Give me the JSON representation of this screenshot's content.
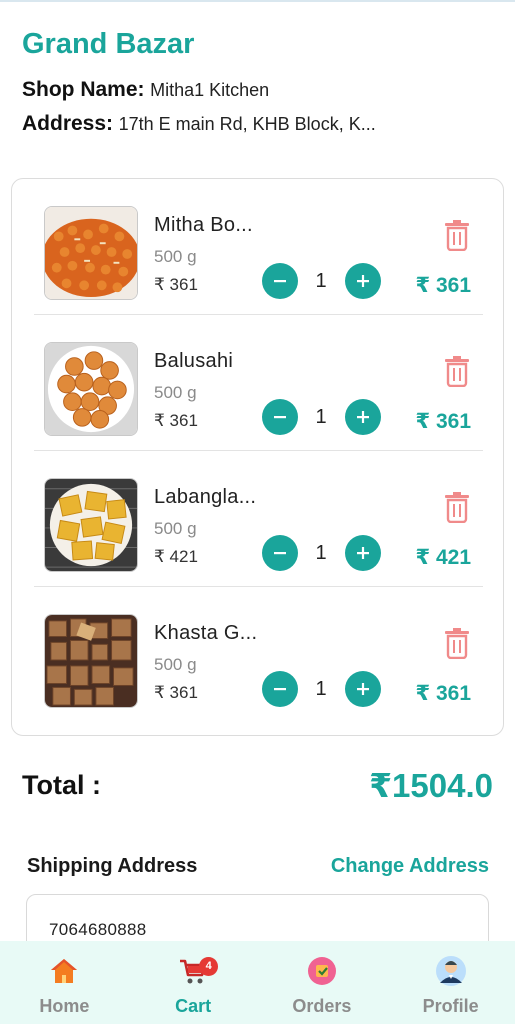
{
  "app": {
    "title": "Grand Bazar"
  },
  "shop": {
    "name_label": "Shop Name:",
    "name_value": "Mitha1 Kitchen",
    "address_label": "Address:",
    "address_value": "17th E main Rd, KHB Block, K..."
  },
  "cart": {
    "items": [
      {
        "name": "Mitha Bo...",
        "weight": "500 g",
        "price": "₹ 361",
        "qty": "1",
        "total": "₹ 361",
        "image": "mitha-boondi-photo"
      },
      {
        "name": "Balusahi",
        "weight": "500 g",
        "price": "₹ 361",
        "qty": "1",
        "total": "₹ 361",
        "image": "balusahi-photo"
      },
      {
        "name": "Labangla...",
        "weight": "500 g",
        "price": "₹ 421",
        "qty": "1",
        "total": "₹ 421",
        "image": "labangalatika-photo"
      },
      {
        "name": "Khasta G...",
        "weight": "500 g",
        "price": "₹ 361",
        "qty": "1",
        "total": "₹ 361",
        "image": "khasta-gaja-photo"
      }
    ],
    "minus_icon": "minus-icon",
    "plus_icon": "plus-icon",
    "delete_icon": "trash-icon"
  },
  "summary": {
    "total_label": "Total :",
    "total_value": "₹1504.0"
  },
  "shipping": {
    "title": "Shipping Address",
    "change_label": "Change Address",
    "phone": "7064680888"
  },
  "nav": {
    "items": [
      {
        "label": "Home",
        "icon": "home-icon",
        "active": false
      },
      {
        "label": "Cart",
        "icon": "cart-icon",
        "active": true,
        "badge": "4"
      },
      {
        "label": "Orders",
        "icon": "orders-icon",
        "active": false
      },
      {
        "label": "Profile",
        "icon": "profile-icon",
        "active": false
      }
    ]
  },
  "colors": {
    "accent": "#1aa59b",
    "delete": "#f08a8a",
    "nav_bg": "#e8faf6",
    "badge": "#e53935"
  }
}
